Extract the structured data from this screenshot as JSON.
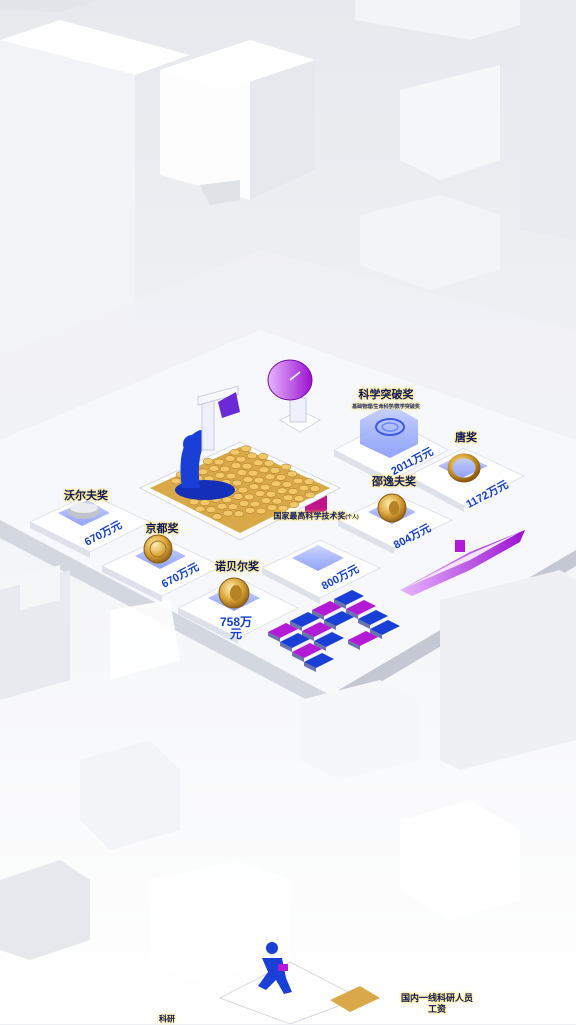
{
  "colors": {
    "background": "#eef0f4",
    "cube_face": "#ffffff",
    "cube_side": "#dde0e6",
    "platform_top": "#f7f8fb",
    "accent_blue": "#1a3fd6",
    "accent_purple": "#b21ad6",
    "label_glow": "#ffd21f",
    "gold": "#d9a53a"
  },
  "awards": [
    {
      "key": "wolf",
      "title": "沃尔夫奖",
      "value": "670万元",
      "icon": "silver-bowl-icon"
    },
    {
      "key": "kyoto",
      "title": "京都奖",
      "value": "670万元",
      "icon": "gold-medal-icon"
    },
    {
      "key": "nobel",
      "title": "诺贝尔奖",
      "value": "758万元",
      "icon": "nobel-medal-icon"
    },
    {
      "key": "national_sci_tech",
      "title": "国家最高科学技术奖",
      "subtitle": "(个人)",
      "value": "800万元",
      "icon": "certificate-icon"
    },
    {
      "key": "shaw",
      "title": "邵逸夫奖",
      "value": "804万元",
      "icon": "gold-medal-icon"
    },
    {
      "key": "breakthrough",
      "title": "科学突破奖",
      "subtitle": "基础物理/生命科学/数学突破奖",
      "value": "2011万元",
      "icon": "glass-bowl-icon"
    },
    {
      "key": "crafoord",
      "title": "唐奖",
      "value": "1172万元",
      "icon": "gold-ring-icon"
    }
  ],
  "bottom_labels": {
    "right": "国内一线科研人员工资",
    "left": "科研"
  },
  "props": [
    "microscope-icon",
    "satellite-dish-icon",
    "aircraft-carrier-icon",
    "gold-coins-icon",
    "figure-runner-icon"
  ]
}
